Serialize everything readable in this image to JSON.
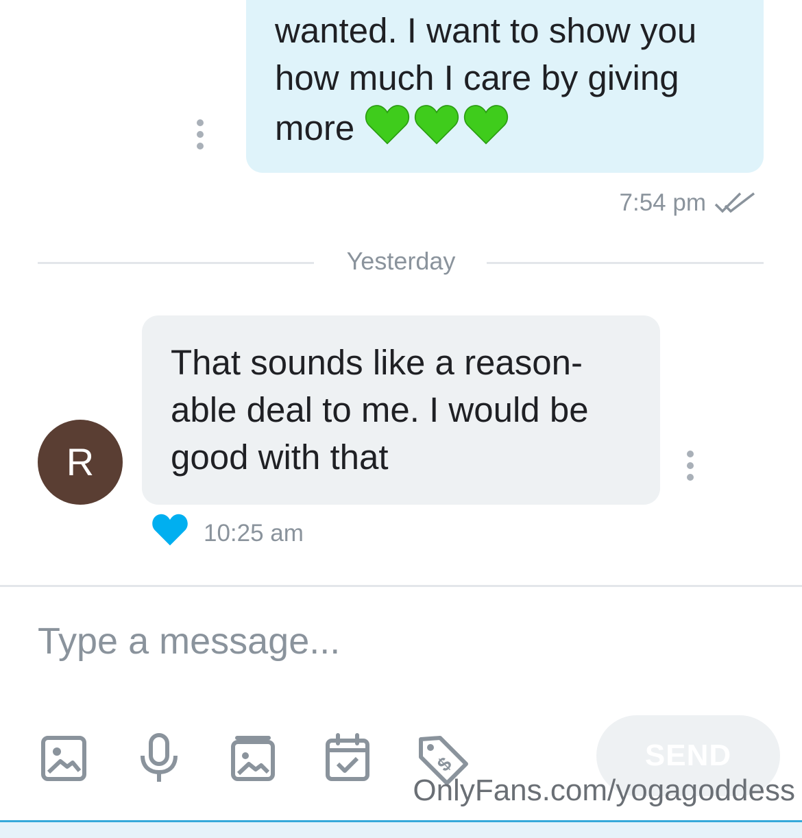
{
  "conversation": {
    "outgoing": {
      "text": "wanted. I want to show you how much I care by giving more",
      "emoji": "💚💚💚",
      "time": "7:54 pm",
      "status_icon": "double-check-icon"
    },
    "date_divider": "Yesterday",
    "incoming": {
      "avatar_initial": "R",
      "text": "That sounds like a reason-able deal to me. I would be good with that",
      "liked_icon": "blue-heart-icon",
      "time": "10:25 am"
    }
  },
  "composer": {
    "placeholder": "Type a message...",
    "tools": [
      "image-icon",
      "microphone-icon",
      "gallery-icon",
      "calendar-check-icon",
      "price-tag-icon"
    ],
    "send_label": "SEND"
  },
  "watermark": "OnlyFans.com/yogagoddess",
  "colors": {
    "outgoing_bubble": "#dff3fa",
    "incoming_bubble": "#eef1f3",
    "accent": "#00aff0",
    "avatar": "#5a3e33",
    "green_heart": "#3fcc1c"
  }
}
